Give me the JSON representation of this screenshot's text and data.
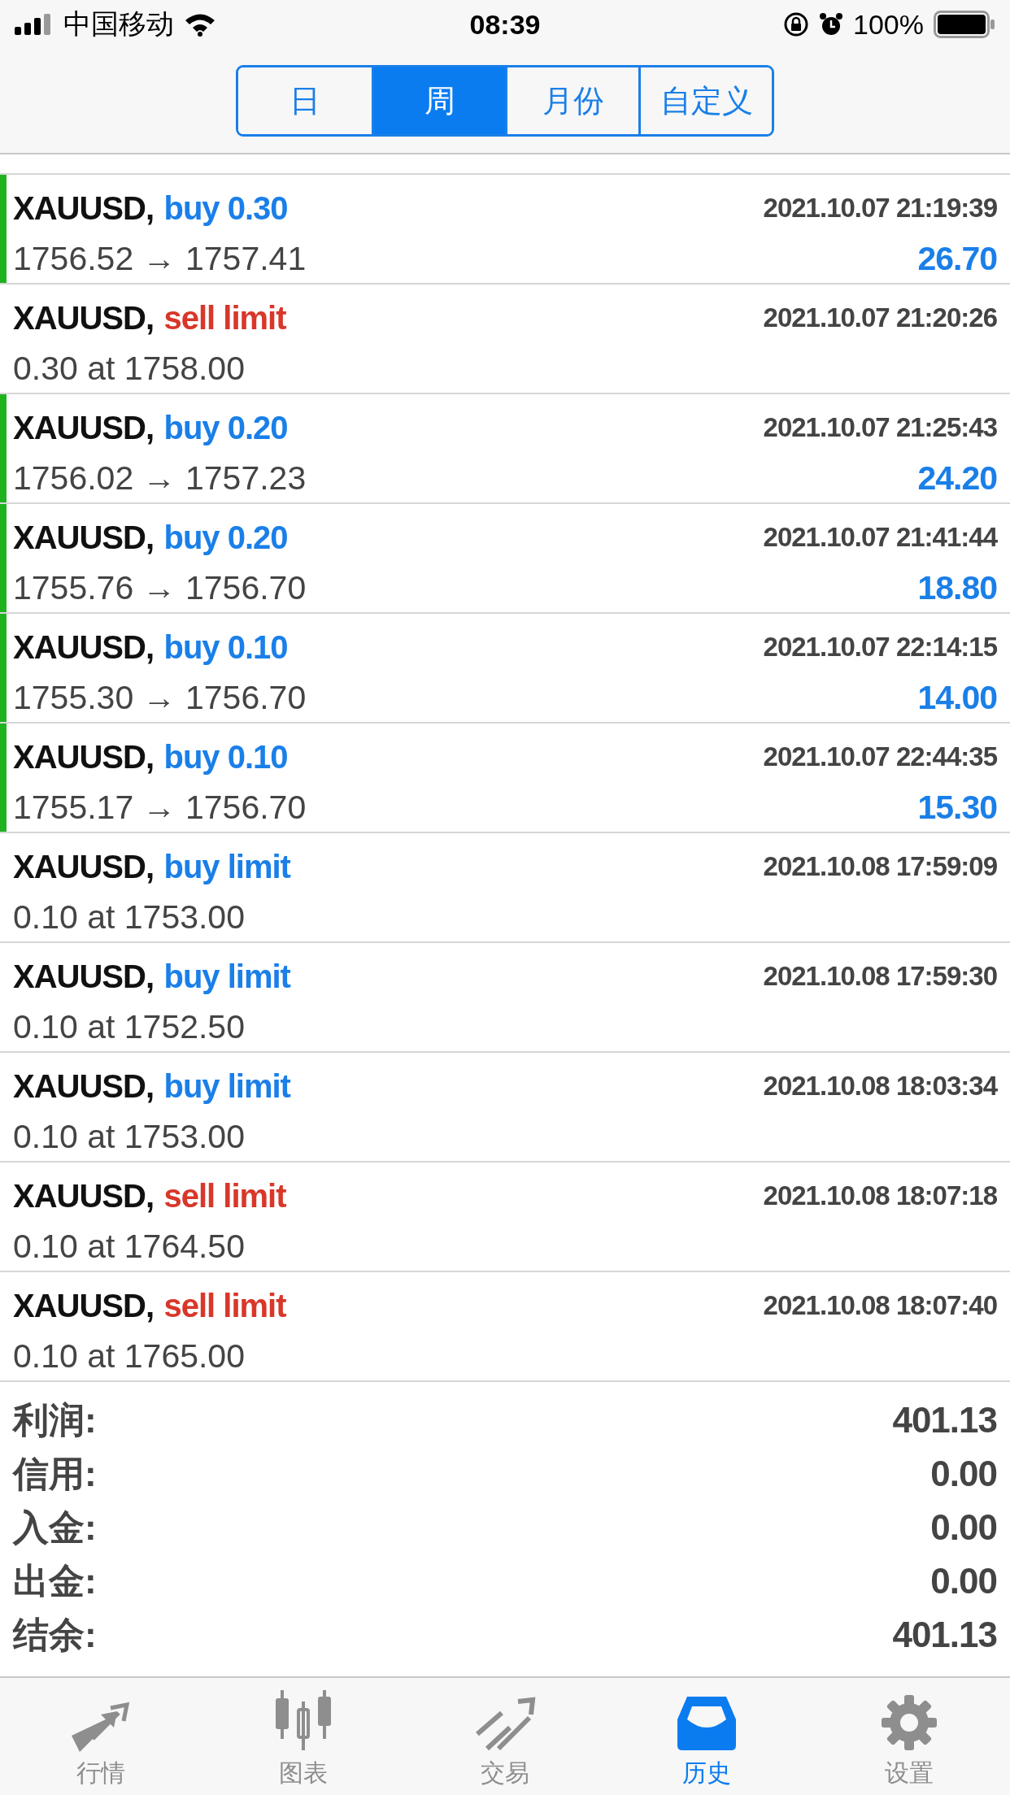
{
  "status_bar": {
    "carrier": "中国移动",
    "time": "08:39",
    "battery": "100%"
  },
  "period_tabs": [
    {
      "label": "日",
      "selected": false
    },
    {
      "label": "周",
      "selected": true
    },
    {
      "label": "月份",
      "selected": false
    },
    {
      "label": "自定义",
      "selected": false
    }
  ],
  "orders": [
    {
      "kind": "deal",
      "symbol": "XAUUSD,",
      "color": "#1a7fe8",
      "type": "buy 0.30",
      "time": "2021.10.07 21:19:39",
      "detail": "1756.52 → 1757.41",
      "profit": "26.70"
    },
    {
      "kind": "order",
      "symbol": "XAUUSD,",
      "color": "#d8372a",
      "type": "sell limit",
      "time": "2021.10.07 21:20:26",
      "detail": "0.30 at 1758.00"
    },
    {
      "kind": "deal",
      "symbol": "XAUUSD,",
      "color": "#1a7fe8",
      "type": "buy 0.20",
      "time": "2021.10.07 21:25:43",
      "detail": "1756.02 → 1757.23",
      "profit": "24.20"
    },
    {
      "kind": "deal",
      "symbol": "XAUUSD,",
      "color": "#1a7fe8",
      "type": "buy 0.20",
      "time": "2021.10.07 21:41:44",
      "detail": "1755.76 → 1756.70",
      "profit": "18.80"
    },
    {
      "kind": "deal",
      "symbol": "XAUUSD,",
      "color": "#1a7fe8",
      "type": "buy 0.10",
      "time": "2021.10.07 22:14:15",
      "detail": "1755.30 → 1756.70",
      "profit": "14.00"
    },
    {
      "kind": "deal",
      "symbol": "XAUUSD,",
      "color": "#1a7fe8",
      "type": "buy 0.10",
      "time": "2021.10.07 22:44:35",
      "detail": "1755.17 → 1756.70",
      "profit": "15.30"
    },
    {
      "kind": "order",
      "symbol": "XAUUSD,",
      "color": "#1a7fe8",
      "type": "buy limit",
      "time": "2021.10.08 17:59:09",
      "detail": "0.10 at 1753.00"
    },
    {
      "kind": "order",
      "symbol": "XAUUSD,",
      "color": "#1a7fe8",
      "type": "buy limit",
      "time": "2021.10.08 17:59:30",
      "detail": "0.10 at 1752.50"
    },
    {
      "kind": "order",
      "symbol": "XAUUSD,",
      "color": "#1a7fe8",
      "type": "buy limit",
      "time": "2021.10.08 18:03:34",
      "detail": "0.10 at 1753.00"
    },
    {
      "kind": "order",
      "symbol": "XAUUSD,",
      "color": "#d8372a",
      "type": "sell limit",
      "time": "2021.10.08 18:07:18",
      "detail": "0.10 at 1764.50"
    },
    {
      "kind": "order",
      "symbol": "XAUUSD,",
      "color": "#d8372a",
      "type": "sell limit",
      "time": "2021.10.08 18:07:40",
      "detail": "0.10 at 1765.00"
    }
  ],
  "summary": [
    {
      "label": "利润:",
      "value": "401.13"
    },
    {
      "label": "信用:",
      "value": "0.00"
    },
    {
      "label": "入金:",
      "value": "0.00"
    },
    {
      "label": "出金:",
      "value": "0.00"
    },
    {
      "label": "结余:",
      "value": "401.13"
    }
  ],
  "tab_bar": [
    {
      "kind": "quotes",
      "label": "行情",
      "selected": false
    },
    {
      "kind": "chart",
      "label": "图表",
      "selected": false
    },
    {
      "kind": "trade",
      "label": "交易",
      "selected": false
    },
    {
      "kind": "history",
      "label": "历史",
      "selected": true
    },
    {
      "kind": "settings",
      "label": "设置",
      "selected": false
    }
  ]
}
